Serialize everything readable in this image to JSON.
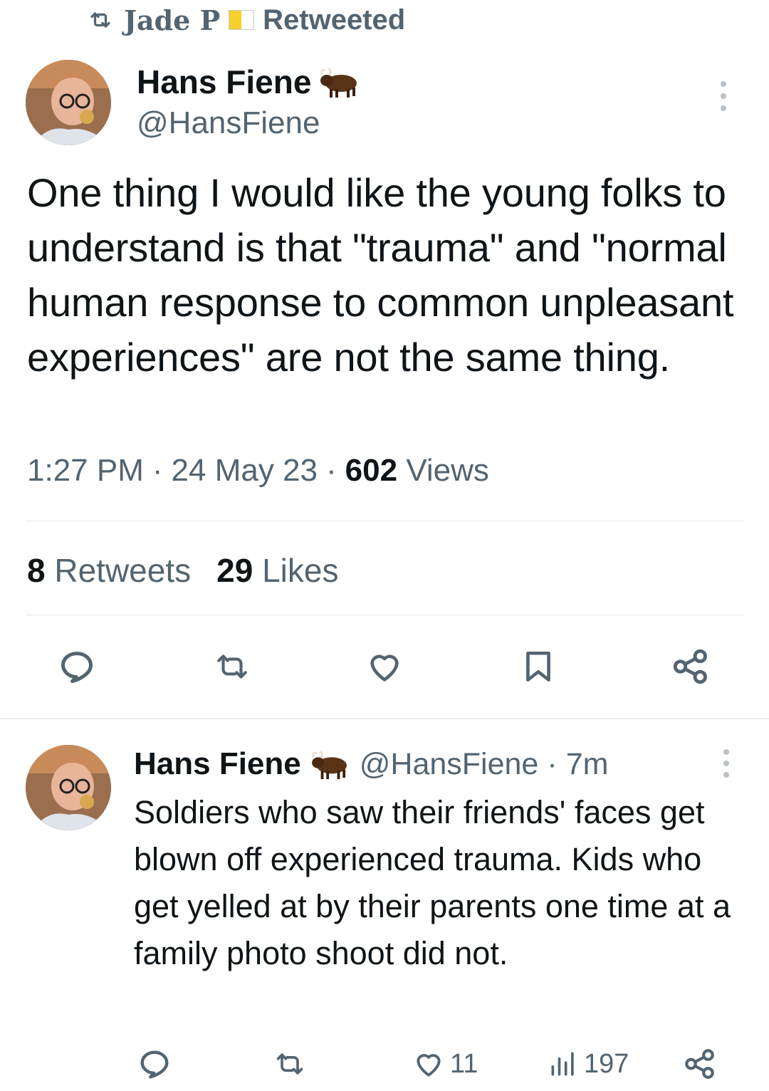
{
  "retweet_bar": {
    "retweeter": "Jade P",
    "label": "Retweeted",
    "icon": "retweet-icon",
    "flag_colors": [
      "#f7cf2b",
      "#ffffff"
    ]
  },
  "main_tweet": {
    "author_name": "Hans Fiene",
    "author_emoji": "ox-icon",
    "handle": "@HansFiene",
    "text": "One thing I would like the young folks to understand is that \"trauma\" and \"normal human response to common unpleasant experiences\" are not the same thing.",
    "time": "1:27 PM",
    "date": "24 May 23",
    "views_count": "602",
    "views_label": "Views",
    "retweets_count": "8",
    "retweets_label": "Retweets",
    "likes_count": "29",
    "likes_label": "Likes",
    "actions": [
      "reply-icon",
      "retweet-icon",
      "like-icon",
      "bookmark-icon",
      "share-icon"
    ]
  },
  "reply": {
    "author_name": "Hans Fiene",
    "handle": "@HansFiene",
    "time_ago": "7m",
    "text": "Soldiers who saw their friends' faces get blown off experienced trauma. Kids who get yelled at by their parents one time at a family photo shoot did not.",
    "likes": "11",
    "views": "197"
  },
  "colors": {
    "text_primary": "#0f1419",
    "text_secondary": "#536471",
    "divider": "#e1e6ea",
    "icon": "#536471"
  }
}
